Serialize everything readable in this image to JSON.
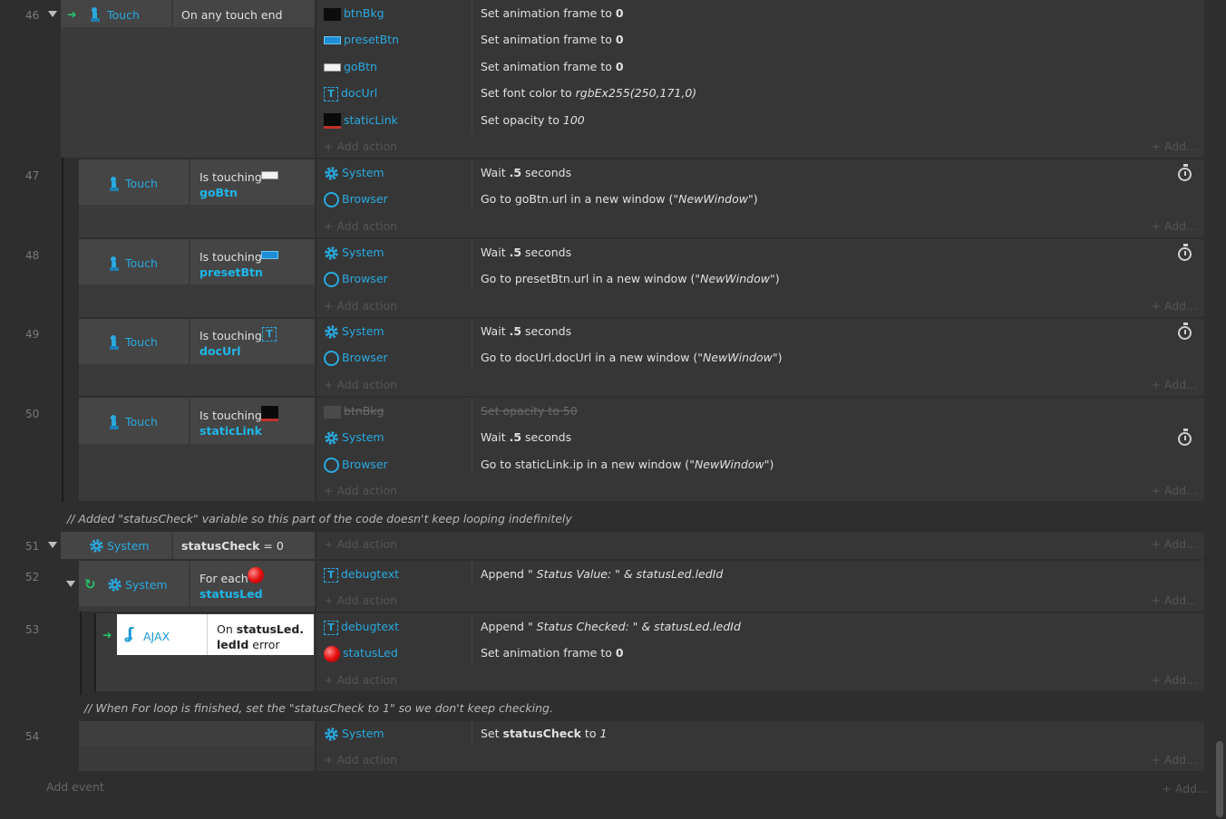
{
  "events": {
    "e46": {
      "num": "46",
      "obj": "Touch",
      "cond": "On any touch end",
      "actions": [
        {
          "obj": "btnBkg",
          "icon": "black-sprite-icon",
          "text_pre": "Set animation frame to ",
          "text_bold": "0"
        },
        {
          "obj": "presetBtn",
          "icon": "preset-button-icon",
          "text_pre": "Set animation frame to ",
          "text_bold": "0"
        },
        {
          "obj": "goBtn",
          "icon": "go-button-icon",
          "text_pre": "Set animation frame to ",
          "text_bold": "0"
        },
        {
          "obj": "docUrl",
          "icon": "text-object-icon",
          "text_pre": "Set font color to ",
          "text_ital": "rgbEx255(250,171,0)"
        },
        {
          "obj": "staticLink",
          "icon": "static-link-icon",
          "text_pre": "Set opacity to ",
          "text_ital": "100"
        }
      ]
    },
    "e47": {
      "num": "47",
      "obj": "Touch",
      "cond_pre": "Is touching",
      "cond_obj": "goBtn",
      "actions": [
        {
          "obj": "System",
          "pre": "Wait ",
          "bold": ".5",
          "post": " seconds"
        },
        {
          "obj": "Browser",
          "pre": "Go to goBtn.url in a new window (\"",
          "ital": "NewWindow",
          "post": "\")"
        }
      ]
    },
    "e48": {
      "num": "48",
      "obj": "Touch",
      "cond_pre": "Is touching",
      "cond_obj": "presetBtn",
      "actions": [
        {
          "obj": "System",
          "pre": "Wait ",
          "bold": ".5",
          "post": " seconds"
        },
        {
          "obj": "Browser",
          "pre": "Go to presetBtn.url in a new window (\"",
          "ital": "NewWindow",
          "post": "\")"
        }
      ]
    },
    "e49": {
      "num": "49",
      "obj": "Touch",
      "cond_pre": "Is touching",
      "cond_obj": "docUrl",
      "actions": [
        {
          "obj": "System",
          "pre": "Wait ",
          "bold": ".5",
          "post": " seconds"
        },
        {
          "obj": "Browser",
          "pre": "Go to docUrl.docUrl in a new window (\"",
          "ital": "NewWindow",
          "post": "\")"
        }
      ]
    },
    "e50": {
      "num": "50",
      "obj": "Touch",
      "cond_pre": "Is touching",
      "cond_obj": "staticLink",
      "disabled_obj": "btnBkg",
      "disabled_text": "Set opacity to 50",
      "actions": [
        {
          "obj": "System",
          "pre": "Wait ",
          "bold": ".5",
          "post": " seconds"
        },
        {
          "obj": "Browser",
          "pre": "Go to staticLink.ip in a new window (\"",
          "ital": "NewWindow",
          "post": "\")"
        }
      ]
    },
    "comment1": "//  Added \"statusCheck\" variable so this part of the code doesn't keep looping indefinitely",
    "e51": {
      "num": "51",
      "obj": "System",
      "cond_bold": "statusCheck",
      "cond_rest": " = 0"
    },
    "e52": {
      "num": "52",
      "obj": "System",
      "cond_pre": "For each",
      "cond_obj": "statusLed",
      "act_obj": "debugtext",
      "act_pre": "Append \"",
      "act_ital": " Status Value: \" & statusLed.ledId"
    },
    "e53": {
      "num": "53",
      "obj": "AJAX",
      "cond_pre": "On ",
      "cond_bold1": "statusLed.",
      "cond_bold2": "ledId",
      "cond_rest": " error",
      "actions": [
        {
          "obj": "debugtext",
          "pre": "Append \"",
          "ital": " Status Checked: \" & statusLed.ledId"
        },
        {
          "obj": "statusLed",
          "pre": "Set animation frame to ",
          "bold": "0"
        }
      ]
    },
    "comment2": "//  When For loop is finished, set the \"statusCheck to 1\" so we don't keep checking.",
    "e54": {
      "num": "54",
      "act_obj": "System",
      "act_pre": "Set ",
      "act_bold": "statusCheck",
      "act_mid": " to ",
      "act_ital": "1"
    }
  },
  "add_action": "Add action",
  "add_dots": "Add...",
  "add_event": "Add event"
}
